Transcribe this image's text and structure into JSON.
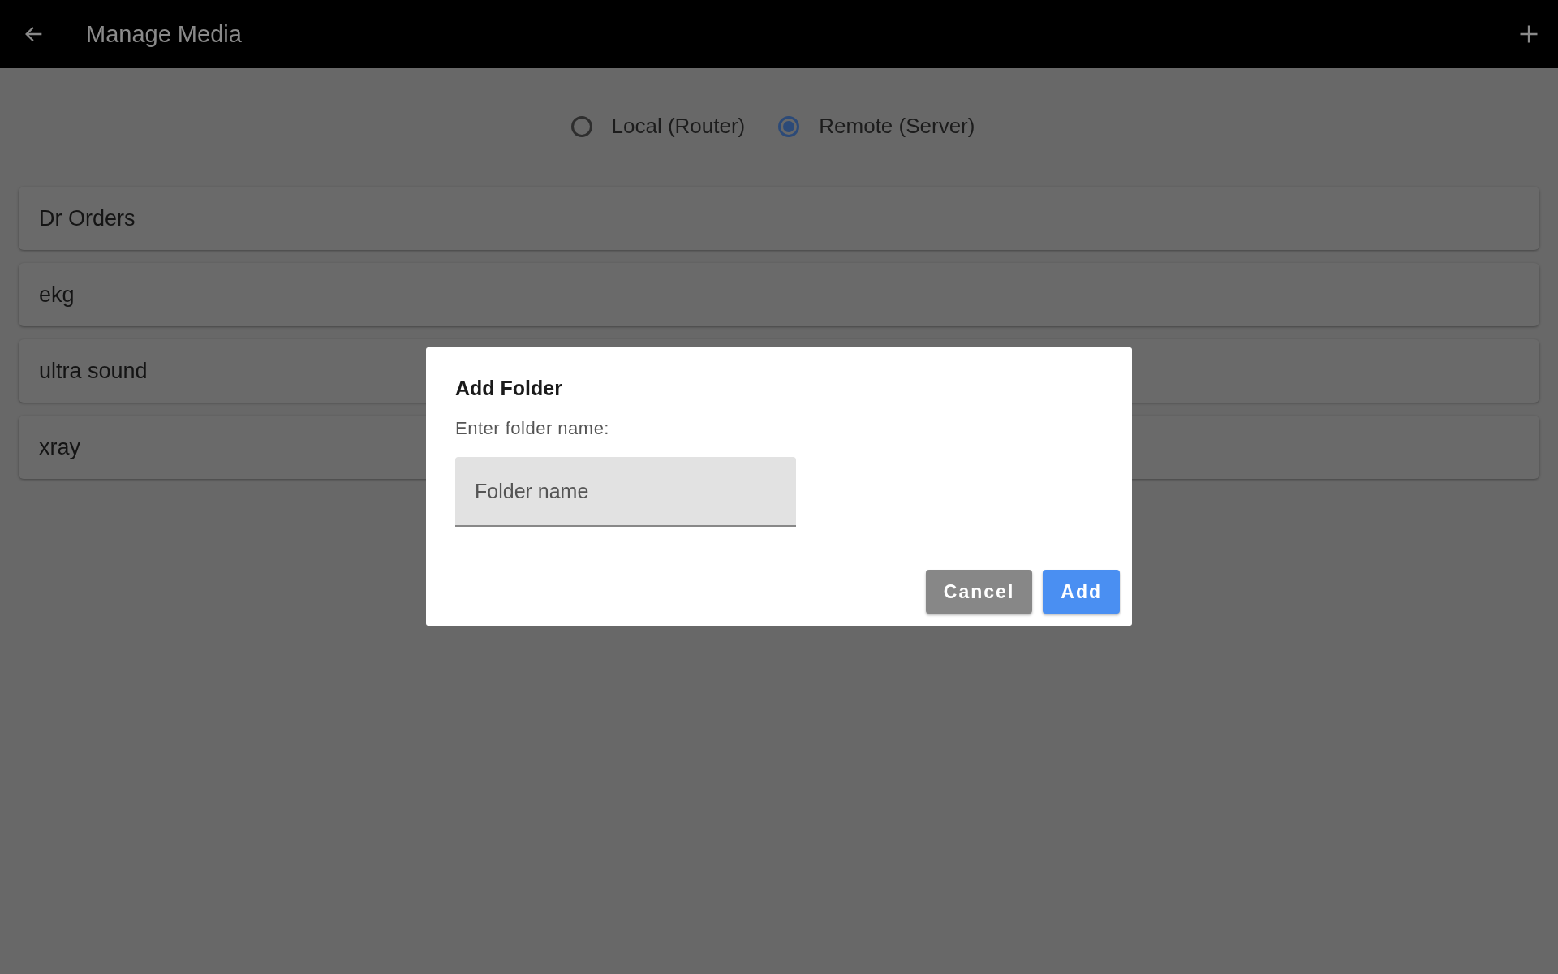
{
  "app_bar": {
    "title": "Manage Media"
  },
  "source_options": [
    {
      "label": "Local (Router)",
      "selected": false
    },
    {
      "label": "Remote (Server)",
      "selected": true
    }
  ],
  "folders": [
    "Dr Orders",
    "ekg",
    "ultra sound",
    "xray"
  ],
  "dialog": {
    "title": "Add Folder",
    "label": "Enter folder name:",
    "field": {
      "placeholder": "Folder name"
    },
    "buttons": [
      {
        "label": "Cancel",
        "kind": "secondary"
      },
      {
        "label": "Add",
        "kind": "primary"
      }
    ]
  }
}
